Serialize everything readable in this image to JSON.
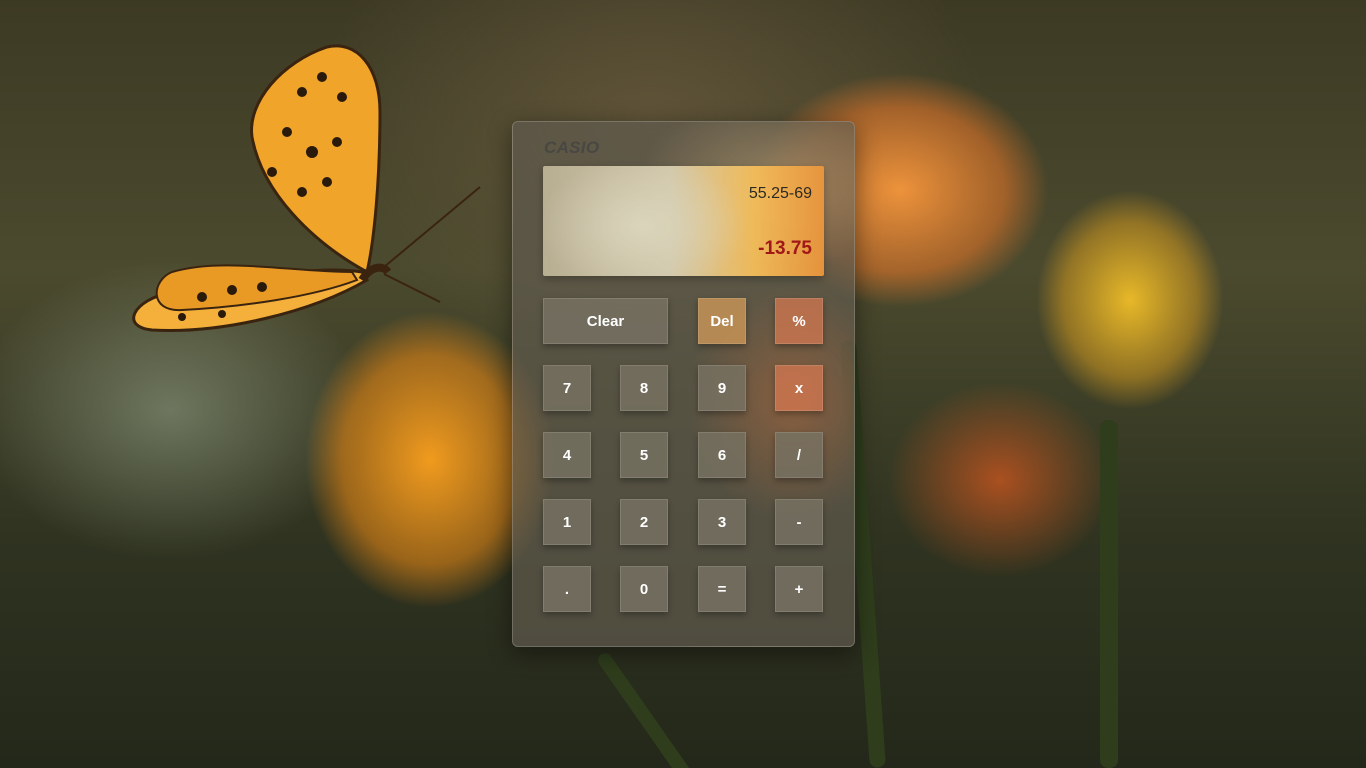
{
  "calculator": {
    "brand": "CASIO",
    "display": {
      "expression": "55.25-69",
      "result": "-13.75"
    },
    "keys": {
      "clear": "Clear",
      "del": "Del",
      "percent": "%",
      "seven": "7",
      "eight": "8",
      "nine": "9",
      "multiply": "x",
      "four": "4",
      "five": "5",
      "six": "6",
      "divide": "/",
      "one": "1",
      "two": "2",
      "three": "3",
      "minus": "-",
      "decimal": ".",
      "zero": "0",
      "equals": "=",
      "plus": "+"
    }
  },
  "colors": {
    "result_text": "#a01818",
    "key_text": "#ffffff"
  },
  "background": {
    "description_icons": [
      "butterfly-icon"
    ]
  }
}
